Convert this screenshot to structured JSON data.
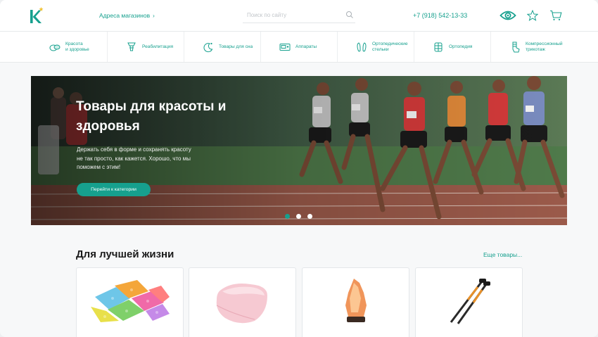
{
  "header": {
    "stores_link": "Адреса магазинов",
    "search_placeholder": "Поиск по сайту",
    "phone": "+7 (918) 542-13-33"
  },
  "categories": [
    {
      "label": "Красота\nи здоровье",
      "icon": "beauty-icon"
    },
    {
      "label": "Реабилитация",
      "icon": "rehab-icon"
    },
    {
      "label": "Товары для сна",
      "icon": "sleep-icon"
    },
    {
      "label": "Аппараты",
      "icon": "devices-icon"
    },
    {
      "label": "Ортопедические\nстельки",
      "icon": "insoles-icon"
    },
    {
      "label": "Ортопедия",
      "icon": "orthopedics-icon"
    },
    {
      "label": "Компрессионный\nтрикотаж",
      "icon": "compression-icon"
    }
  ],
  "hero": {
    "title": "Товары для красоты и здоровья",
    "text": "Держать себя в форме и сохранять красоту не так просто, как кажется. Хорошо, что мы поможем с этим!",
    "button": "Перейти к категории",
    "slides": 3,
    "active_slide": 1
  },
  "products": {
    "title": "Для лучшей жизни",
    "more": "Еще товары...",
    "items": [
      {
        "image": "massage-mat-puzzles"
      },
      {
        "image": "orthopedic-pillow"
      },
      {
        "image": "salt-lamp"
      },
      {
        "image": "nordic-walking-poles"
      }
    ]
  },
  "colors": {
    "accent": "#16a08e",
    "background": "#f7f8f9"
  }
}
